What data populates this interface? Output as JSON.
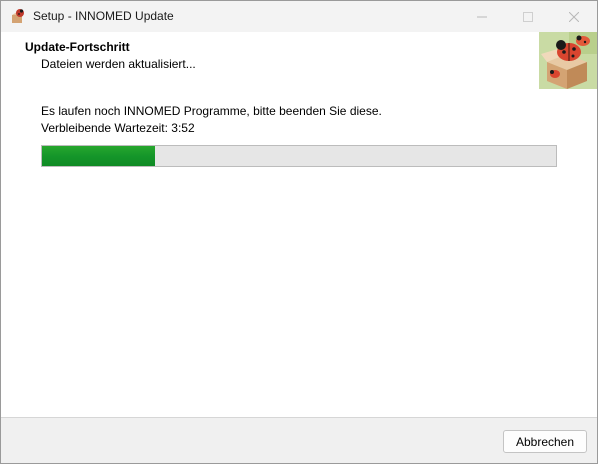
{
  "window": {
    "title": "Setup - INNOMED Update",
    "controls": [
      "minimize-icon",
      "maximize-icon",
      "close-icon"
    ]
  },
  "header": {
    "title": "Update-Fortschritt",
    "subtitle": "Dateien werden aktualisiert..."
  },
  "main": {
    "message": "Es laufen noch INNOMED Programme, bitte beenden Sie diese.",
    "remaining": "Verbleibende Wartezeit: 3:52",
    "progress_percent": 22,
    "progress_color": "#15962a"
  },
  "footer": {
    "cancel_label": "Abbrechen"
  }
}
